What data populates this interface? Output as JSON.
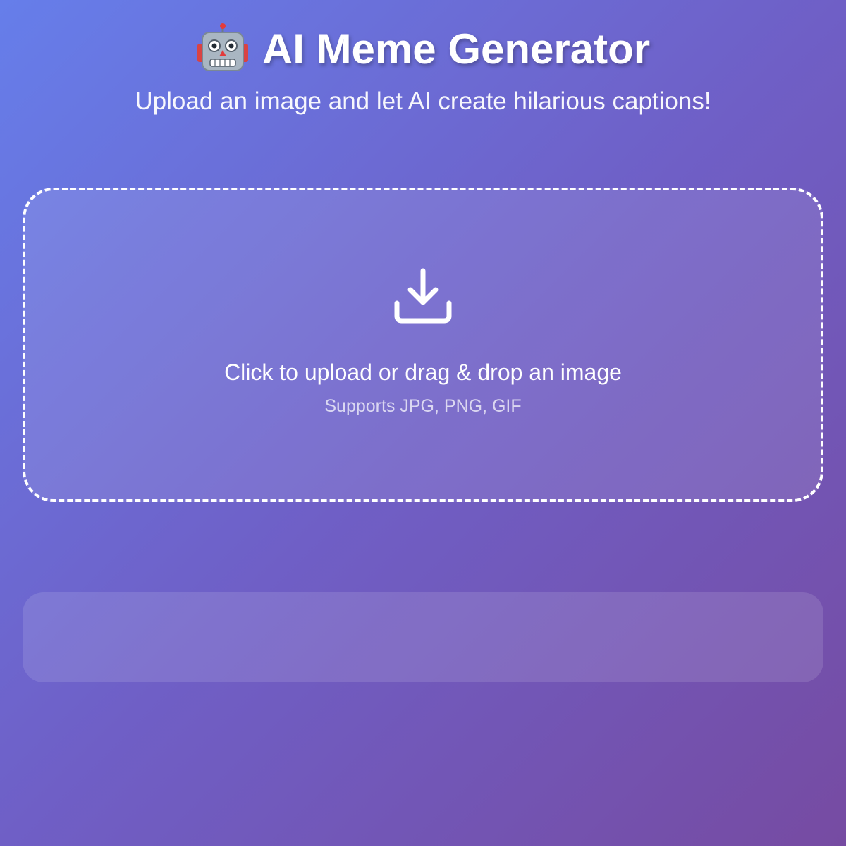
{
  "header": {
    "icon": "robot-face-icon",
    "title": "AI Meme Generator",
    "subtitle": "Upload an image and let AI create hilarious captions!"
  },
  "upload": {
    "icon": "download-tray-icon",
    "prompt": "Click to upload or drag & drop an image",
    "hint": "Supports JPG, PNG, GIF"
  },
  "colors": {
    "gradient_start": "#667eea",
    "gradient_end": "#764ba2",
    "text": "#ffffff"
  }
}
